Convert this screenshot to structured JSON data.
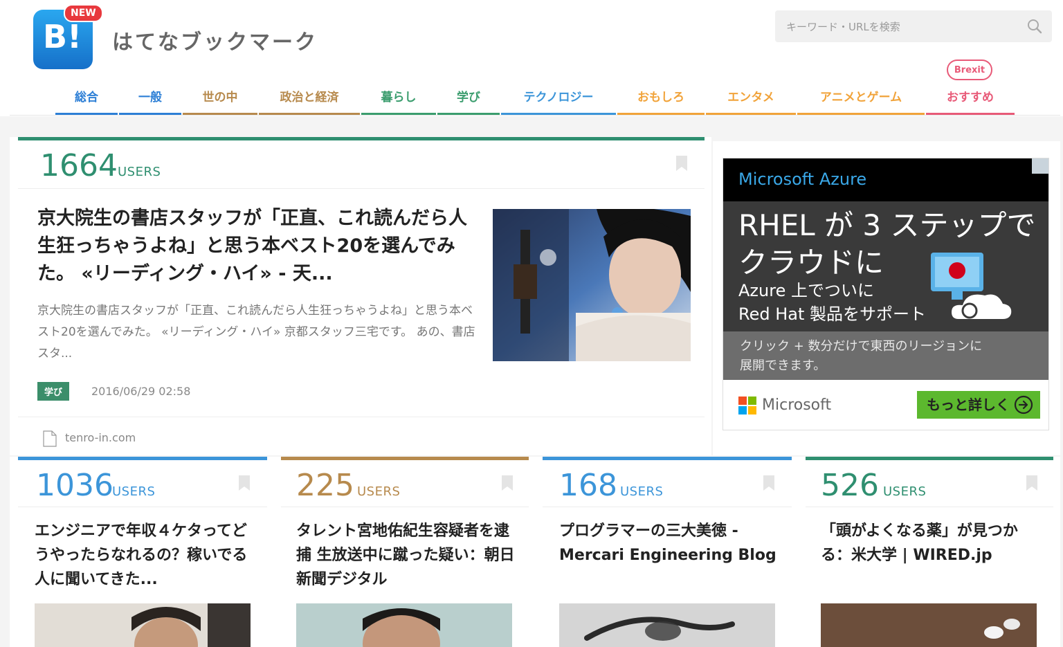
{
  "header": {
    "logo_text": "B!",
    "new_badge": "NEW",
    "site_name": "はてなブックマーク",
    "search_placeholder": "キーワード・URLを検索"
  },
  "nav": {
    "items": [
      {
        "label": "総合",
        "color": "#2d7fd6"
      },
      {
        "label": "一般",
        "color": "#2d7fd6"
      },
      {
        "label": "世の中",
        "color": "#b78a4d"
      },
      {
        "label": "政治と経済",
        "color": "#b78a4d"
      },
      {
        "label": "暮らし",
        "color": "#3b9d6e"
      },
      {
        "label": "学び",
        "color": "#3b9d6e"
      },
      {
        "label": "テクノロジー",
        "color": "#3c95d9"
      },
      {
        "label": "おもしろ",
        "color": "#f1a33a"
      },
      {
        "label": "エンタメ",
        "color": "#f1a33a"
      },
      {
        "label": "アニメとゲーム",
        "color": "#f1a33a"
      },
      {
        "label": "おすすめ",
        "color": "#e85a78"
      }
    ],
    "brexit_badge": "Brexit"
  },
  "featured": {
    "users": "1664",
    "users_label": "USERS",
    "accent": "#2f8f70",
    "title": "京大院生の書店スタッフが「正直、これ読んだら人生狂っちゃうよね」と思う本ベスト20を選んでみた。 «リーディング・ハイ» - 天...",
    "excerpt": "京大院生の書店スタッフが「正直、これ読んだら人生狂っちゃうよね」と思う本ベスト20を選んでみた。 «リーディング・ハイ» 京都スタッフ三宅です。 あの、書店スタ...",
    "tag": "学び",
    "date": "2016/06/29 02:58",
    "domain": "tenro-in.com"
  },
  "ad": {
    "brand": "Microsoft Azure",
    "headline": "RHEL が 3 ステップでクラウドに",
    "sub1": "Azure 上でついに",
    "sub2": "Red Hat 製品をサポート",
    "strip_line1": "クリック + 数分だけで東西のリージョンに",
    "strip_line2": "展開できます。",
    "company": "Microsoft",
    "cta": "もっと詳しく"
  },
  "cards": [
    {
      "users": "1036",
      "users_label": "USERS",
      "accent": "#3c95d9",
      "title": "エンジニアで年収４ケタってどうやったらなれるの？稼いでる人に聞いてきた..."
    },
    {
      "users": "225",
      "users_label": "USERS",
      "accent": "#b78a4d",
      "title": "タレント宮地佑紀生容疑者を逮捕 生放送中に蹴った疑い：朝日新聞デジタル"
    },
    {
      "users": "168",
      "users_label": "USERS",
      "accent": "#3c95d9",
      "title": "プログラマーの三大美徳 - Mercari Engineering Blog"
    },
    {
      "users": "526",
      "users_label": "USERS",
      "accent": "#2f8f70",
      "title": "「頭がよくなる薬」が見つかる：米大学 | WIRED.jp"
    }
  ]
}
